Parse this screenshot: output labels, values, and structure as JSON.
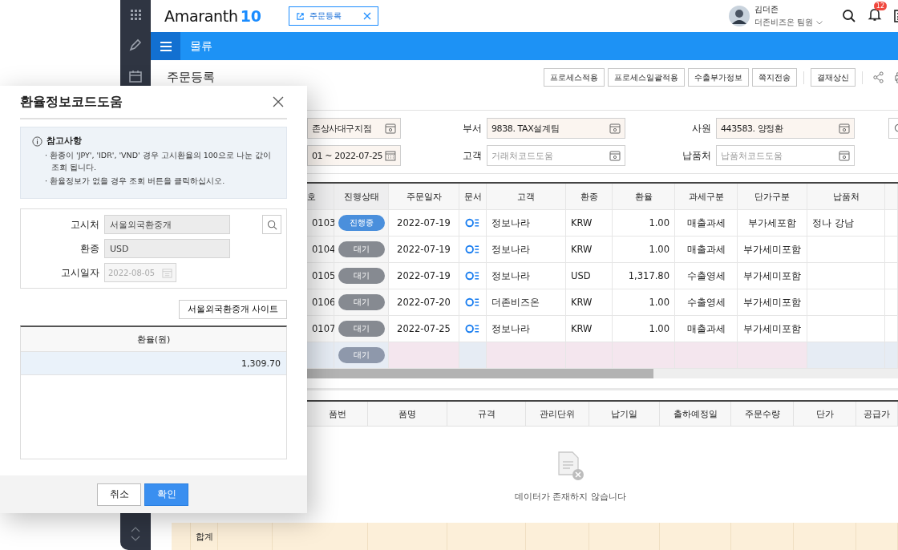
{
  "header": {
    "logo": {
      "name": "Amaranth",
      "version": "10"
    },
    "open_tab": {
      "label": "주문등록"
    },
    "user": {
      "name": "김더존",
      "subtitle": "더존비즈온 팀원"
    },
    "notifications": {
      "badge": "12"
    }
  },
  "menu_bar": {
    "title": "물류"
  },
  "page": {
    "title": "주문등록",
    "buttons": [
      {
        "label": "프로세스적용"
      },
      {
        "label": "프로세스일괄적용"
      },
      {
        "label": "수출부가정보"
      },
      {
        "label": "쪽지전송"
      },
      {
        "label": "결재상신"
      }
    ]
  },
  "filters": [
    [
      {
        "kind": "code",
        "value": "존상사대구지점",
        "required": true
      },
      {
        "kind": "code",
        "label": "부서",
        "value": "9838. TAX설계팀",
        "required": true
      },
      {
        "kind": "code",
        "label": "사원",
        "value": "443583. 양정환",
        "required": true
      }
    ],
    [
      {
        "kind": "date",
        "value": "01 ~ 2022-07-25",
        "required": true
      },
      {
        "kind": "code",
        "label": "고객",
        "placeholder": "거래처코드도움",
        "required": false
      },
      {
        "kind": "code",
        "label": "납품처",
        "placeholder": "납품처코드도움",
        "required": false
      }
    ]
  ],
  "orders_table": {
    "columns": [
      "호",
      "진행상태",
      "주문일자",
      "문서",
      "고객",
      "환종",
      "환율",
      "과세구분",
      "단가구분",
      "납품처"
    ],
    "rows": [
      {
        "kind": "order",
        "no": "0103",
        "status": "진행중",
        "color": "#4a8fdc",
        "date": "2022-07-19",
        "customer": "정보나라",
        "currency": "KRW",
        "rate": "1.00",
        "tax": "매출과세",
        "price_type": "부가세포함",
        "delivery": "정나 강남"
      },
      {
        "kind": "order",
        "no": "0104",
        "status": "대기",
        "color": "#868a91",
        "date": "2022-07-19",
        "customer": "정보나라",
        "currency": "KRW",
        "rate": "1.00",
        "tax": "매출과세",
        "price_type": "부가세미포함"
      },
      {
        "kind": "order",
        "no": "0105",
        "status": "대기",
        "color": "#868a91",
        "date": "2022-07-19",
        "customer": "정보나라",
        "currency": "USD",
        "rate": "1,317.80",
        "tax": "수출영세",
        "price_type": "부가세미포함"
      },
      {
        "kind": "order",
        "no": "0106",
        "status": "대기",
        "color": "#868a91",
        "date": "2022-07-20",
        "customer": "더존비즈온",
        "currency": "KRW",
        "rate": "1.00",
        "tax": "수출영세",
        "price_type": "부가세미포함"
      },
      {
        "kind": "order",
        "no": "0107",
        "status": "대기",
        "color": "#868a91",
        "date": "2022-07-25",
        "customer": "정보나라",
        "currency": "KRW",
        "rate": "1.00",
        "tax": "매출과세",
        "price_type": "부가세미포함"
      },
      {
        "kind": "new",
        "status": "대기",
        "color": "#8e98ab"
      }
    ]
  },
  "items_table": {
    "columns": [
      "품번",
      "품명",
      "규격",
      "관리단위",
      "납기일",
      "출하예정일",
      "주문수량",
      "단가",
      "공급가"
    ],
    "empty_message": "데이터가 존재하지 않습니다",
    "total_label": "합계"
  },
  "dialog": {
    "title": "환율정보코드도움",
    "notice": {
      "heading": "참고사항",
      "items": [
        "· 환종이 'JPY', 'IDR', 'VND' 경우 고시환율의 100으로 나눈 값이 조회 됩니다.",
        "· 환율정보가 없을 경우 조회 버튼을 클릭하십시오."
      ]
    },
    "fields": [
      {
        "kind": "lookup",
        "label": "고시처",
        "value": "서울외국환중개",
        "disabled": false
      },
      {
        "kind": "text",
        "label": "환종",
        "value": "USD",
        "disabled": false
      },
      {
        "kind": "date",
        "label": "고시일자",
        "value": "2022-08-05",
        "disabled": true
      }
    ],
    "site_button": "서울외국환중개 사이트",
    "grid": {
      "columns": [
        "환율(원)"
      ],
      "rows": [
        {
          "rate": "1,309.70",
          "selected": true
        }
      ]
    },
    "buttons": [
      {
        "label": "취소",
        "kind": "secondary"
      },
      {
        "label": "확인",
        "kind": "primary"
      }
    ]
  }
}
